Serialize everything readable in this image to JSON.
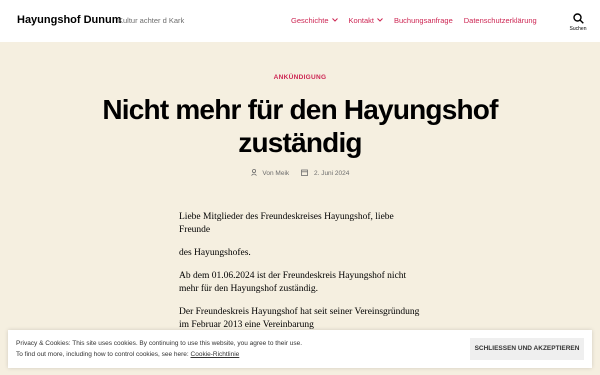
{
  "header": {
    "site_title": "Hayungshof Dunum",
    "site_description": "Kultur achter d Kark",
    "nav": [
      {
        "label": "Geschichte",
        "has_dropdown": true
      },
      {
        "label": "Kontakt",
        "has_dropdown": true
      },
      {
        "label": "Buchungsanfrage",
        "has_dropdown": false
      },
      {
        "label": "Datenschutzerklärung",
        "has_dropdown": false
      }
    ],
    "search_label": "Suchen"
  },
  "post": {
    "category": "ANKÜNDIGUNG",
    "title": "Nicht mehr für den Hayungshof zuständig",
    "author": "Von Meik",
    "date": "2. Juni 2024",
    "paragraphs": [
      "Liebe Mitglieder des Freundeskreises Hayungshof, liebe Freunde",
      "des Hayungshofes.",
      "Ab dem 01.06.2024 ist der Freundeskreis Hayungshof nicht mehr für den Hayungshof zuständig.",
      "Der Freundeskreis Hayungshof hat seit seiner Vereinsgründung im Februar 2013 eine Vereinbarung"
    ]
  },
  "cookie_banner": {
    "line1": "Privacy & Cookies: This site uses cookies. By continuing to use this website, you agree to their use.",
    "line2_prefix": "To find out more, including how to control cookies, see here: ",
    "link_label": "Cookie-Richtlinie",
    "button_label": "SCHLIESSEN UND AKZEPTIEREN"
  },
  "colors": {
    "accent": "#cd2653",
    "background": "#f5efe0",
    "header_bg": "#ffffff"
  }
}
